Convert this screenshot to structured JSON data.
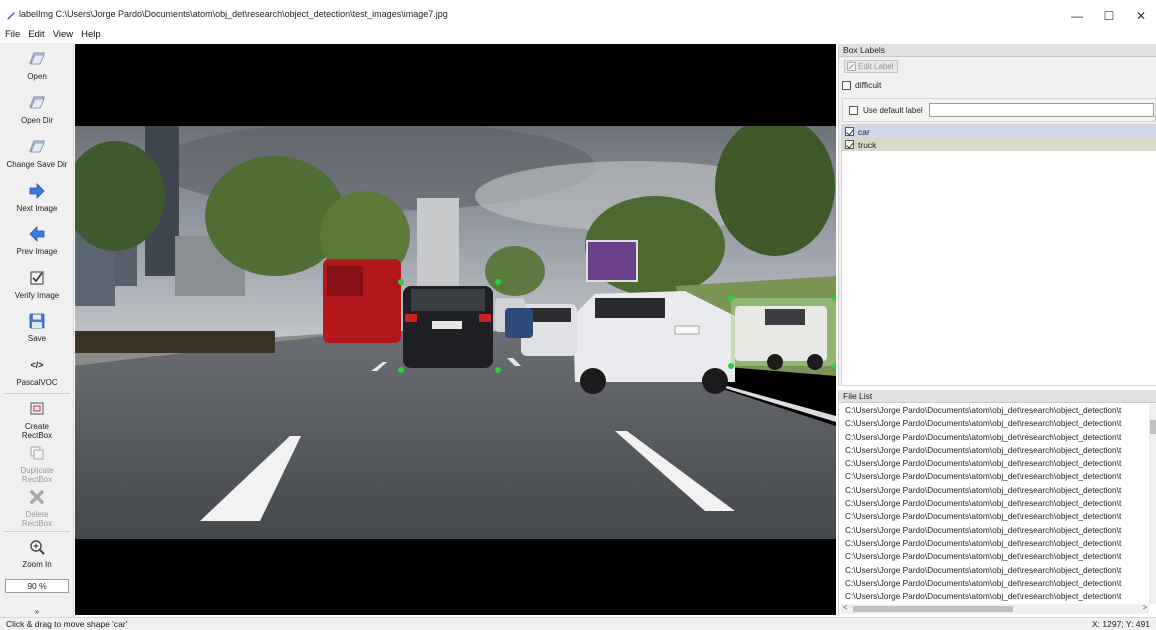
{
  "window": {
    "title": "labelImg C:\\Users\\Jorge Pardo\\Documents\\atom\\obj_det\\research\\object_detection\\test_images\\image7.jpg",
    "minimize_glyph": "—",
    "maximize_glyph": "☐",
    "close_glyph": "✕"
  },
  "menu": {
    "file": "File",
    "edit": "Edit",
    "view": "View",
    "help": "Help"
  },
  "toolbar": {
    "open": "Open",
    "open_dir": "Open Dir",
    "change_save_dir": "Change Save Dir",
    "next_image": "Next Image",
    "prev_image": "Prev Image",
    "verify_image": "Verify Image",
    "save": "Save",
    "format_glyph": "</>",
    "format": "PascalVOC",
    "create_rectbox": "Create\nRectBox",
    "duplicate_rectbox": "Duplicate\nRectBox",
    "delete_rectbox": "Delete\nRectBox",
    "zoom_in": "Zoom In",
    "zoom_value": "90 %",
    "more": "»"
  },
  "box_labels": {
    "header": "Box Labels",
    "edit_label": "Edit Label",
    "difficult": "difficult",
    "use_default_label": "Use default label",
    "labels": [
      {
        "name": "car",
        "checked": true
      },
      {
        "name": "truck",
        "checked": true
      }
    ]
  },
  "file_list": {
    "header": "File List",
    "files": [
      "C:\\Users\\Jorge Pardo\\Documents\\atom\\obj_det\\research\\object_detection\\t",
      "C:\\Users\\Jorge Pardo\\Documents\\atom\\obj_det\\research\\object_detection\\t",
      "C:\\Users\\Jorge Pardo\\Documents\\atom\\obj_det\\research\\object_detection\\t",
      "C:\\Users\\Jorge Pardo\\Documents\\atom\\obj_det\\research\\object_detection\\t",
      "C:\\Users\\Jorge Pardo\\Documents\\atom\\obj_det\\research\\object_detection\\t",
      "C:\\Users\\Jorge Pardo\\Documents\\atom\\obj_det\\research\\object_detection\\t",
      "C:\\Users\\Jorge Pardo\\Documents\\atom\\obj_det\\research\\object_detection\\t",
      "C:\\Users\\Jorge Pardo\\Documents\\atom\\obj_det\\research\\object_detection\\t",
      "C:\\Users\\Jorge Pardo\\Documents\\atom\\obj_det\\research\\object_detection\\t",
      "C:\\Users\\Jorge Pardo\\Documents\\atom\\obj_det\\research\\object_detection\\t",
      "C:\\Users\\Jorge Pardo\\Documents\\atom\\obj_det\\research\\object_detection\\t",
      "C:\\Users\\Jorge Pardo\\Documents\\atom\\obj_det\\research\\object_detection\\t",
      "C:\\Users\\Jorge Pardo\\Documents\\atom\\obj_det\\research\\object_detection\\t",
      "C:\\Users\\Jorge Pardo\\Documents\\atom\\obj_det\\research\\object_detection\\t",
      "C:\\Users\\Jorge Pardo\\Documents\\atom\\obj_det\\research\\object_detection\\t"
    ],
    "scroll_left": "<",
    "scroll_right": ">"
  },
  "status": {
    "message": "Click & drag to move shape 'car'",
    "coords": "X: 1297; Y: 491"
  },
  "colors": {
    "vertex_point": "#2ecc40",
    "truck_selection_tint": "#a8d08d",
    "car_row_bg": "#cfd8e8",
    "truck_row_bg": "#d9d9c8"
  }
}
